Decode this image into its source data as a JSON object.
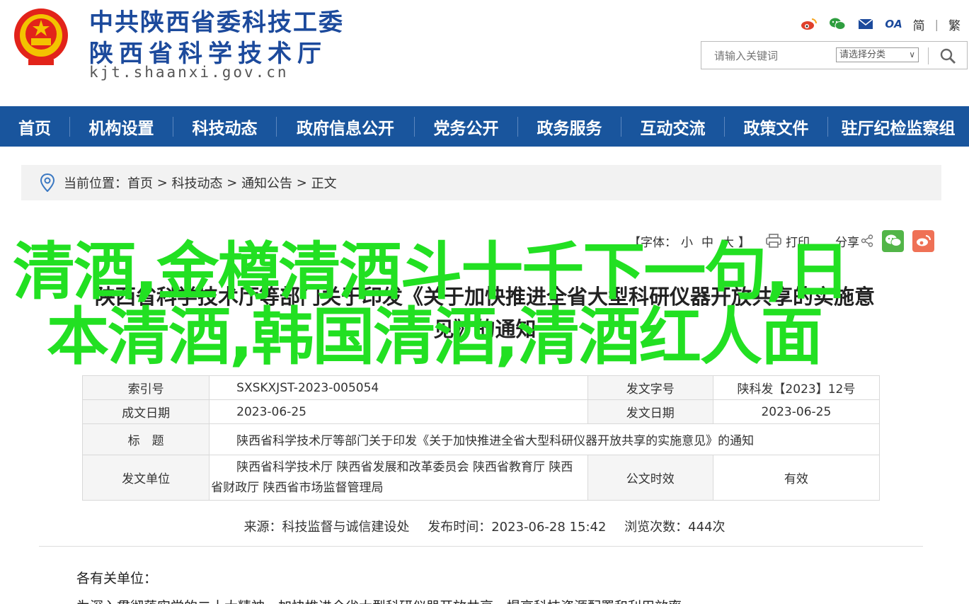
{
  "header": {
    "title_line1": "中共陕西省委科技工委",
    "title_line2": "陕西省科学技术厅",
    "domain": "kjt.shaanxi.gov.cn",
    "icons": [
      "weibo-icon",
      "wechat-icon",
      "mail-icon",
      "oa-icon"
    ],
    "oa_label": "OA",
    "lang_simplified": "简",
    "lang_sep": "|",
    "lang_traditional": "繁"
  },
  "search": {
    "placeholder": "请输入关键词",
    "category_label": "请选择分类",
    "chevron": "∨"
  },
  "nav": {
    "items": [
      "首页",
      "机构设置",
      "科技动态",
      "政府信息公开",
      "党务公开",
      "政务服务",
      "互动交流",
      "政策文件",
      "驻厅纪检监察组"
    ]
  },
  "breadcrumb": {
    "prefix": "当前位置：",
    "items": [
      "首页",
      "科技动态",
      "通知公告",
      "正文"
    ],
    "sep": " > "
  },
  "tools": {
    "font_label": "【字体：",
    "font_small": "小",
    "font_medium": "中",
    "font_large": "大",
    "font_close": "】",
    "print": "打印",
    "share": "分享"
  },
  "article": {
    "title_line1": "陕西省科学技术厅等部门关于印发《关于加快推进全省大型科研仪器开放共享的实施意",
    "title_line2": "见》的通知"
  },
  "overlay": {
    "line1": "清酒,金樽清酒斗十千下一句,日",
    "line2": "本清酒,韩国清酒,清酒红人面"
  },
  "meta": {
    "index_label": "索引号",
    "index_value": "SXSKXJST-2023-005054",
    "doc_no_label": "发文字号",
    "doc_no_value": "陕科发【2023】12号",
    "created_label": "成文日期",
    "created_value": "2023-06-25",
    "issued_label": "发文日期",
    "issued_value": "2023-06-25",
    "subject_label": "标　题",
    "subject_value": "陕西省科学技术厅等部门关于印发《关于加快推进全省大型科研仪器开放共享的实施意见》的通知",
    "issuer_label": "发文单位",
    "issuer_value": "陕西省科学技术厅 陕西省发展和改革委员会 陕西省教育厅 陕西省财政厅 陕西省市场监督管理局",
    "validity_label": "公文时效",
    "validity_value": "有效"
  },
  "source": {
    "source_text": "来源：科技监督与诚信建设处",
    "published_text": "发布时间：2023-06-28 15:42",
    "views_text": "浏览次数：444次"
  },
  "body": {
    "greeting": "各有关单位：",
    "cut_line": "为深入贯彻落实党的二十大精神，加快推进全省大型科研仪器开放共享，提高科技资源配置和利用效率"
  },
  "colors": {
    "brand_blue": "#1c4a9c",
    "nav_blue": "#19559d",
    "overlay_green": "#22e022",
    "wechat_green": "#52b548",
    "weibo_red": "#ef7156"
  }
}
